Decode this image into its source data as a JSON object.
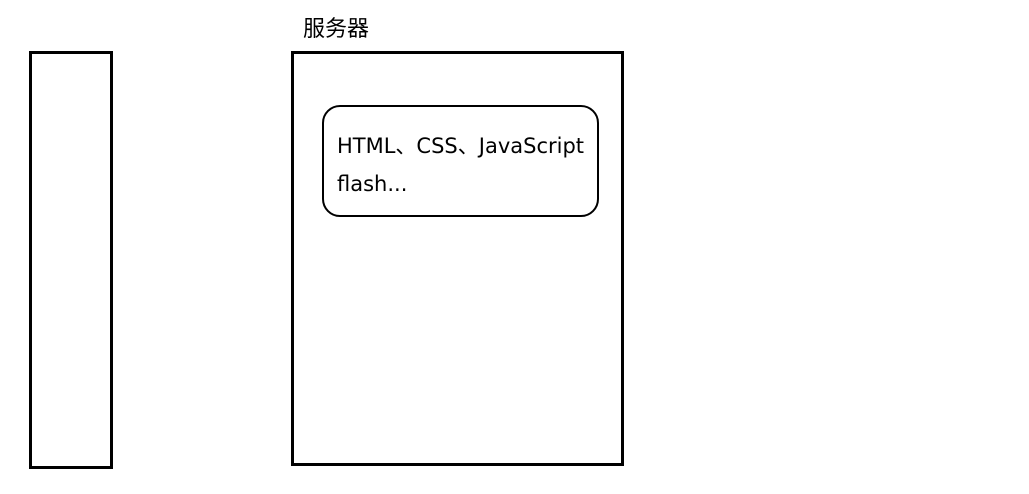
{
  "server": {
    "label": "服务器",
    "content_lines": [
      "HTML、CSS、JavaScript",
      "flash..."
    ]
  }
}
